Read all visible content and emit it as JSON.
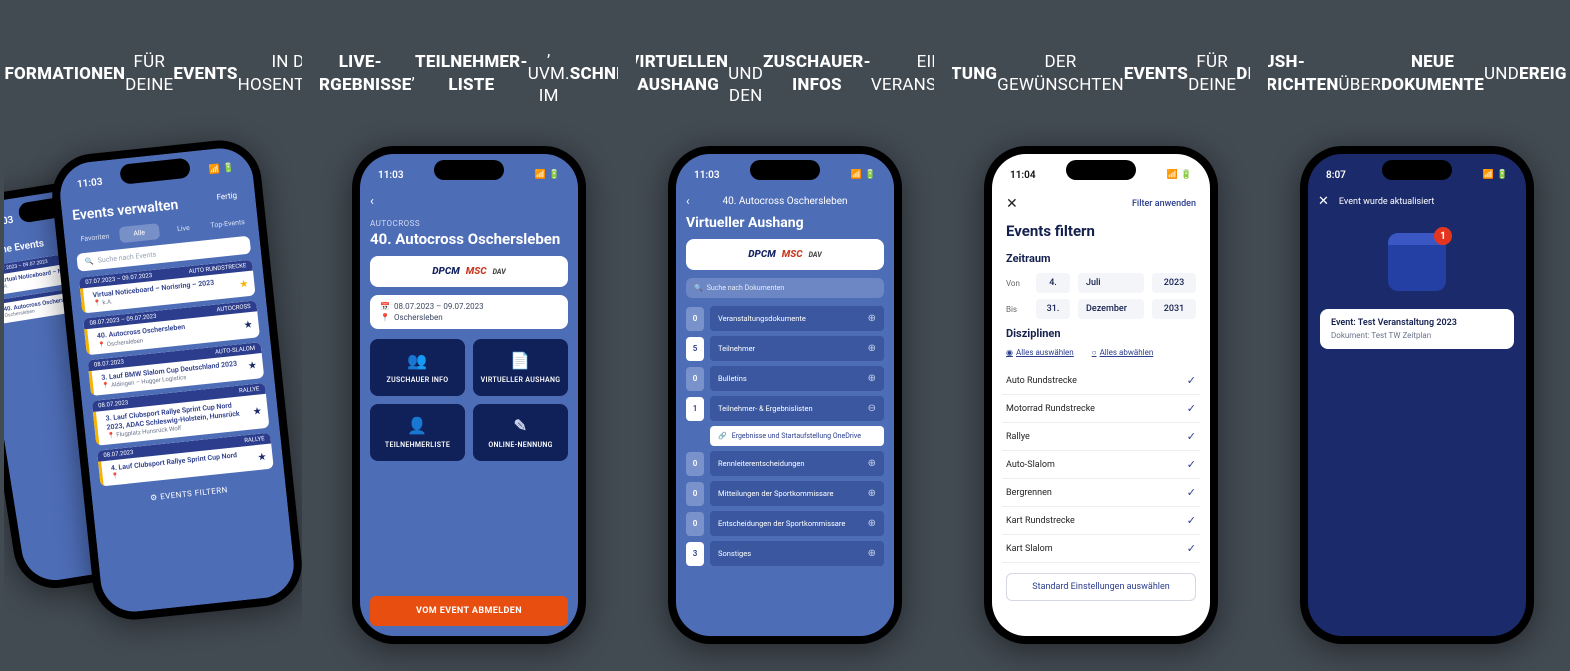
{
  "panels": {
    "p1": {
      "headline_html": "ALLE <b>INFORMATIONEN</b> FÜR<br>DEINE <b>EVENTS</b> IN DER<br>HOSENTASCHE",
      "statusbar_time_back": "11:03",
      "statusbar_time_front": "11:03",
      "back_title": "Meine Events",
      "back_events": [
        {
          "date": "07.07.2023 – 09.07.2023",
          "title": "Virtual Noticeboard – Norisring 2023",
          "loc": "k.A."
        },
        {
          "date": "",
          "title": "40. Autocross Oschersleben",
          "loc": "Oschersleben"
        }
      ],
      "front_title": "Events verwalten",
      "front_done": "Fertig",
      "tabs": [
        "Favoriten",
        "Alle",
        "Live",
        "Top-Events"
      ],
      "tab_active": 1,
      "search_placeholder": "Suche nach Events",
      "events": [
        {
          "date": "07.07.2023 – 09.07.2023",
          "cat": "AUTO RUNDSTRECKE",
          "title": "Virtual Noticeboard – Norisring – 2023",
          "loc": "k.A.",
          "star": true
        },
        {
          "date": "08.07.2023 – 09.07.2023",
          "cat": "AUTOCROSS",
          "title": "40. Autocross Oschersleben",
          "loc": "Oschersleben",
          "star": false
        },
        {
          "date": "08.07.2023",
          "cat": "AUTO-SLALOM",
          "title": "3. Lauf BMW Slalom Cup Deutschland 2023",
          "loc": "Aldingen – Hugger Logistics",
          "star": false
        },
        {
          "date": "08.07.2023",
          "cat": "RALLYE",
          "title": "3. Lauf Clubsport Rallye Sprint Cup Nord 2023, ADAC Schleswig-Holstein, Hunsrück",
          "loc": "Flugplatz Hunsrück Wolf",
          "star": false
        },
        {
          "date": "08.07.2023",
          "cat": "RALLYE",
          "title": "4. Lauf Clubsport Rallye Sprint Cup Nord",
          "loc": "",
          "star": false
        }
      ],
      "filter_label": "EVENTS FILTERN"
    },
    "p2": {
      "headline_html": "<b>ONLINE-NENNUNG</b>,<br><b>LIVE-ERGEBNISSE</b>,<br><b>TEILNEHMER-LISTE</b>, UVM. IM<br><b>SCHNELLZUGRIFF</b>",
      "statusbar_time": "11:03",
      "category": "AUTOCROSS",
      "title": "40. Autocross Oschersleben",
      "logos": [
        "DPCM",
        "MSC",
        "DAV"
      ],
      "date": "08.07.2023 – 09.07.2023",
      "location": "Oschersleben",
      "tiles": [
        "ZUSCHAUER INFO",
        "VIRTUELLER AUSHANG",
        "TEILNEHMERLISTE",
        "ONLINE-NENNUNG"
      ],
      "unregister": "VOM EVENT ABMELDEN"
    },
    "p3": {
      "headline_html": "ZUGRIFF AUF DEN<br><b>VIRTUELLEN AUSHANG</b><br>UND DEN <b>ZUSCHAUER-INFOS</b> EINER<br>VERANSTALTUNG",
      "statusbar_time": "11:03",
      "header": "40. Autocross Oschersleben",
      "title": "Virtueller Aushang",
      "logos": [
        "DPCM",
        "MSC",
        "DAV"
      ],
      "search_placeholder": "Suche nach Dokumenten",
      "rows": [
        {
          "n": "0",
          "label": "Veranstaltungsdokumente",
          "white": false,
          "open": false
        },
        {
          "n": "5",
          "label": "Teilnehmer",
          "white": true,
          "open": false
        },
        {
          "n": "0",
          "label": "Bulletins",
          "white": false,
          "open": false
        },
        {
          "n": "1",
          "label": "Teilnehmer- & Ergebnislisten",
          "white": true,
          "open": true
        },
        {
          "n": "0",
          "label": "Rennleiterentscheidungen",
          "white": false,
          "open": false
        },
        {
          "n": "0",
          "label": "Mitteilungen der Sportkommissare",
          "white": false,
          "open": false
        },
        {
          "n": "0",
          "label": "Entscheidungen der Sportkommissare",
          "white": false,
          "open": false
        },
        {
          "n": "3",
          "label": "Sonstiges",
          "white": true,
          "open": false
        }
      ],
      "subdoc": "Ergebnisse und Startaufstellung OneDrive"
    },
    "p4": {
      "headline_html": "<b>VERWALTUNG</b> DER GEWÜNSCHTEN<br><b>EVENTS</b> FÜR DEINE <b>DISZIPLIN</b>",
      "statusbar_time": "11:04",
      "apply": "Filter anwenden",
      "title": "Events filtern",
      "section_period": "Zeitraum",
      "from_label": "Von",
      "to_label": "Bis",
      "from": {
        "d": "4.",
        "m": "Juli",
        "y": "2023"
      },
      "to": {
        "d": "31.",
        "m": "Dezember",
        "y": "2031"
      },
      "section_disc": "Disziplinen",
      "select_all": "Alles auswählen",
      "deselect_all": "Alles abwählen",
      "disciplines": [
        "Auto Rundstrecke",
        "Motorrad Rundstrecke",
        "Rallye",
        "Auto-Slalom",
        "Bergrennen",
        "Kart Rundstrecke",
        "Kart Slalom"
      ],
      "std_button": "Standard Einstellungen auswählen"
    },
    "p5": {
      "headline_html": "<b>PUSH-NACHRICHTEN</b><br>ÜBER <b>NEUE DOKUMENTE</b> UND<br><b>EREIGNISSE</b>",
      "statusbar_time": "8:07",
      "header": "Event wurde aktualisiert",
      "badge_count": "1",
      "notif_title": "Event: Test Veranstaltung 2023",
      "notif_sub": "Dokument: Test TW Zeitplan"
    }
  }
}
